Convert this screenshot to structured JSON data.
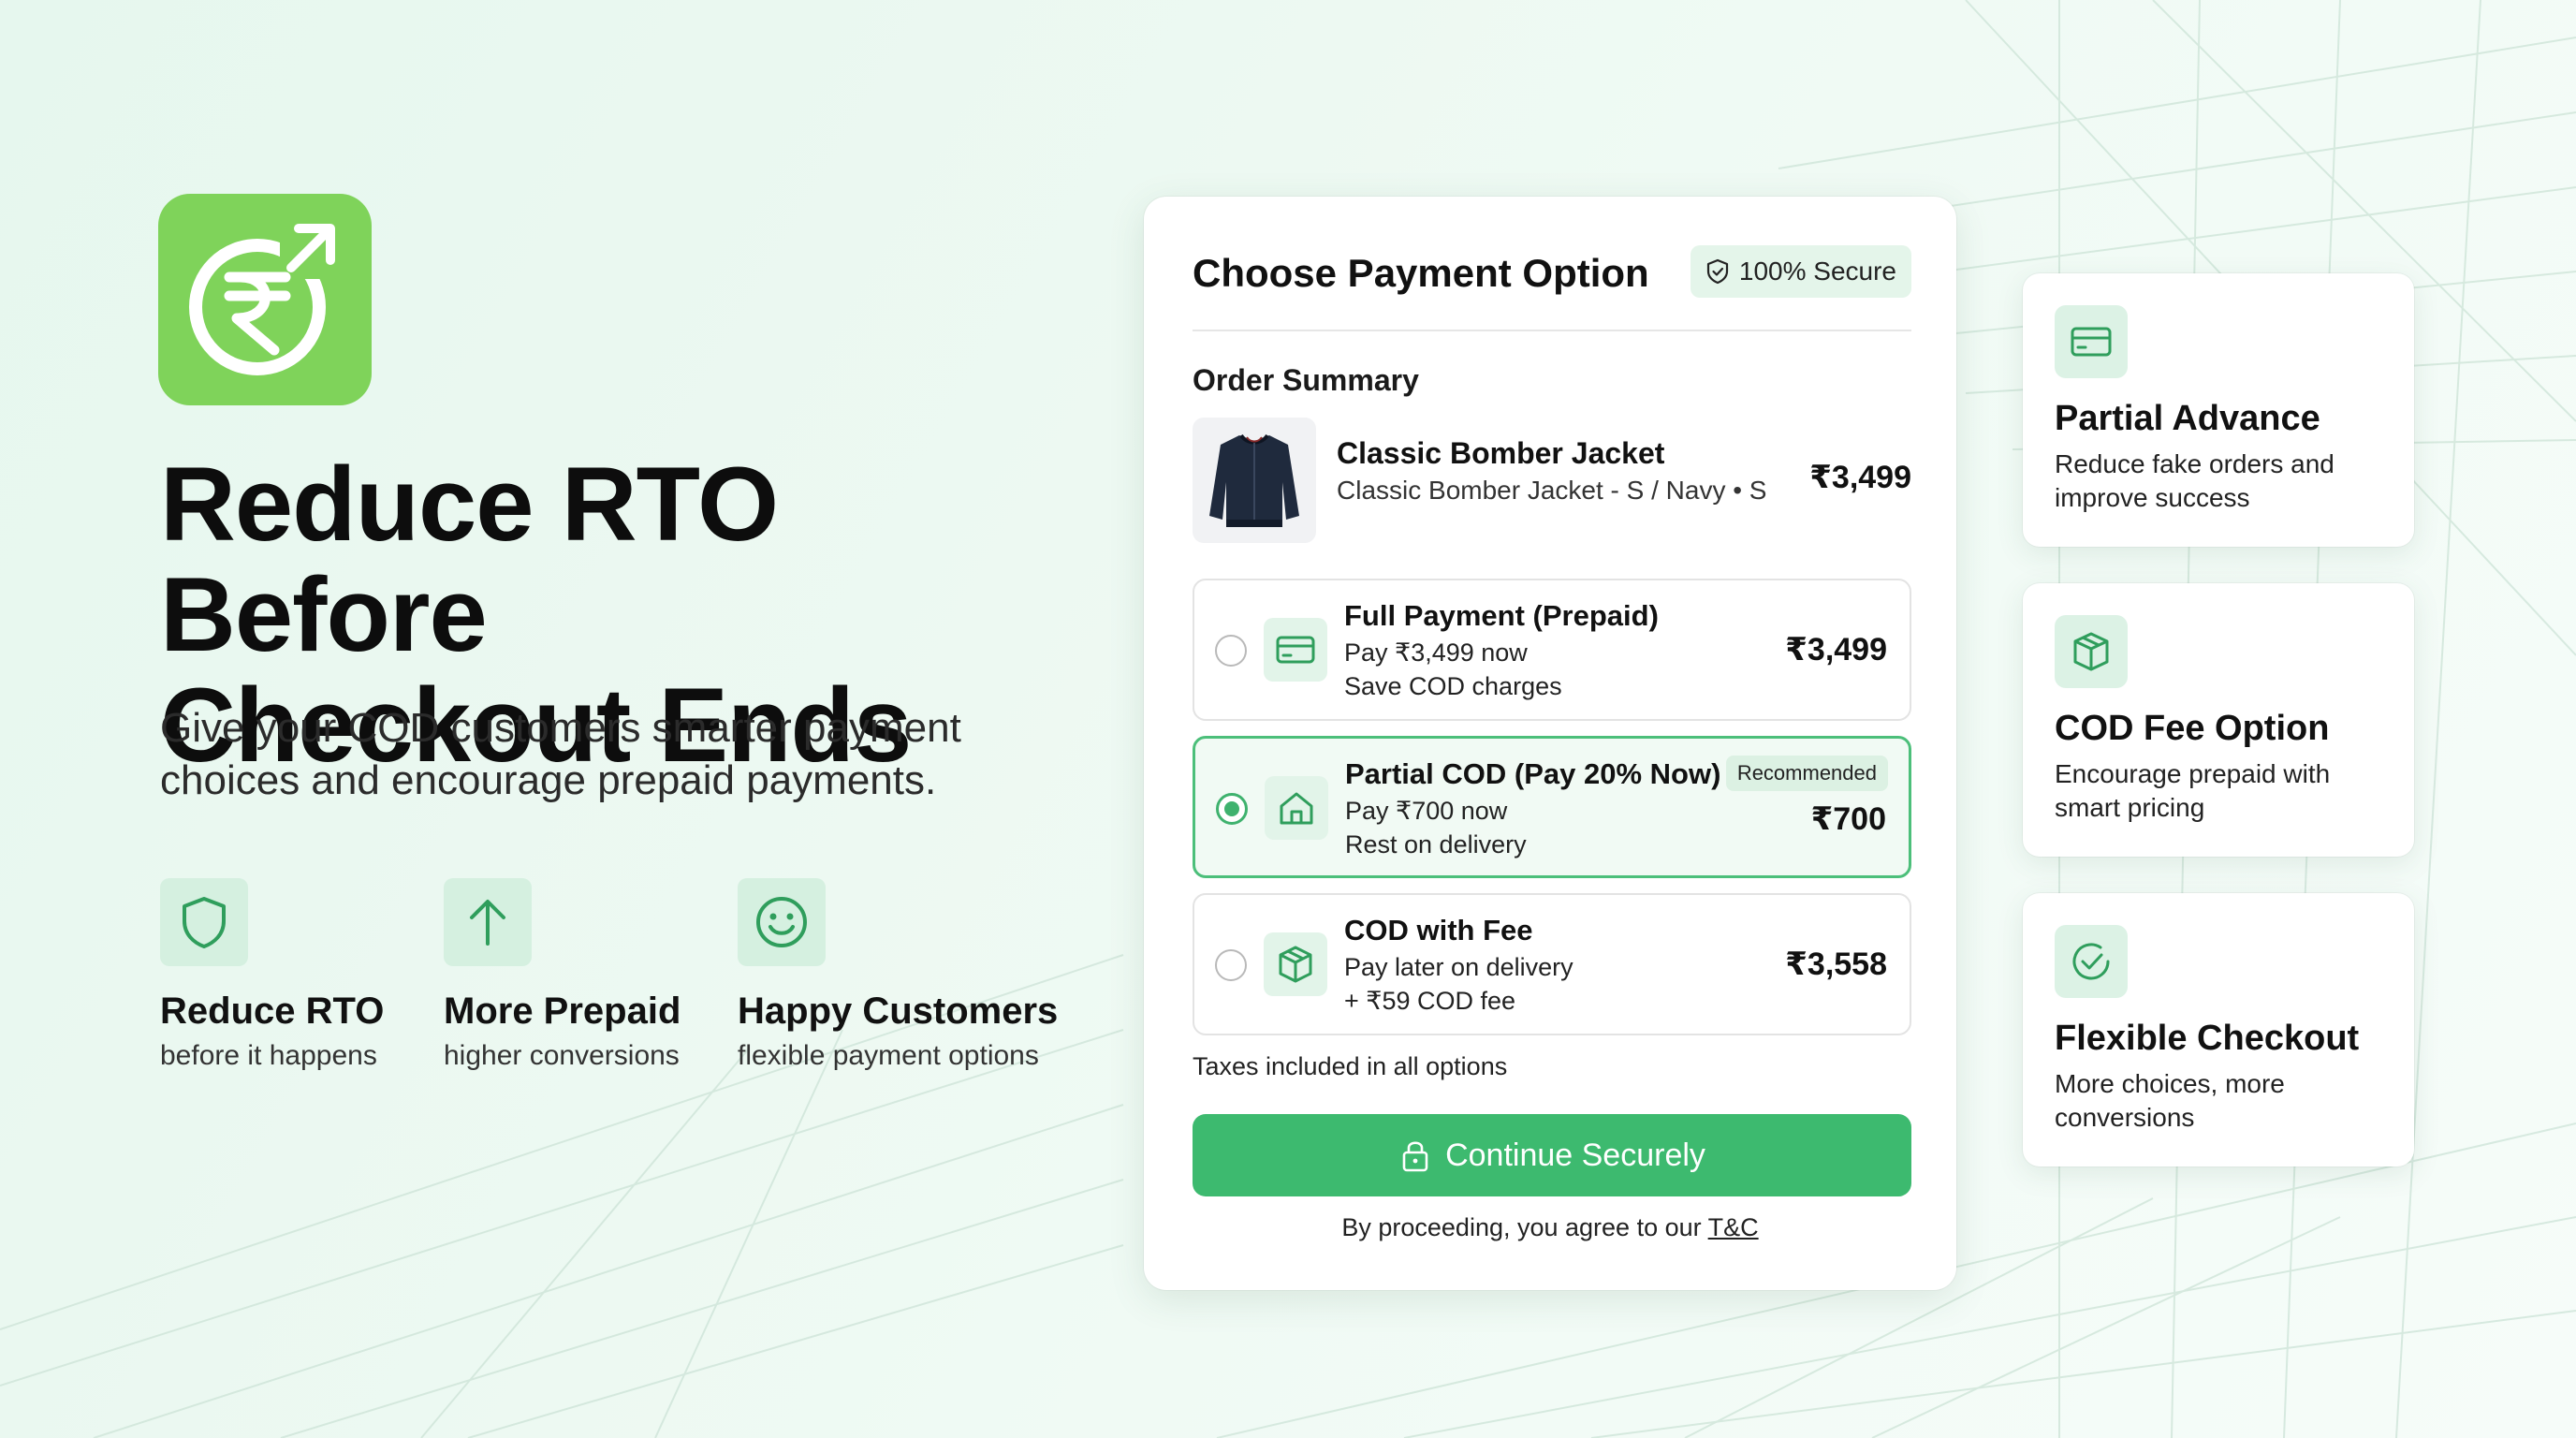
{
  "hero": {
    "headline_line1": "Reduce RTO Before",
    "headline_line2": "Checkout Ends",
    "subtext_line1": "Give your COD customers smarter payment",
    "subtext_line2": "choices and encourage prepaid payments."
  },
  "features": [
    {
      "icon": "shield-icon",
      "title": "Reduce RTO",
      "subtitle": "before it happens"
    },
    {
      "icon": "arrow-up-icon",
      "title": "More Prepaid",
      "subtitle": "higher conversions"
    },
    {
      "icon": "smiley-icon",
      "title": "Happy Customers",
      "subtitle": "flexible payment options"
    }
  ],
  "checkout": {
    "title": "Choose Payment Option",
    "secure_badge": "100% Secure",
    "order_summary_label": "Order Summary",
    "product": {
      "name": "Classic Bomber Jacket",
      "variant": "Classic Bomber Jacket - S / Navy • S",
      "price": "₹3,499"
    },
    "options": [
      {
        "title": "Full Payment (Prepaid)",
        "line1": "Pay ₹3,499 now",
        "line2": "Save COD charges",
        "price": "₹3,499",
        "icon": "credit-card-icon",
        "selected": false
      },
      {
        "title": "Partial COD (Pay 20% Now)",
        "line1": "Pay ₹700 now",
        "line2": "Rest on delivery",
        "price": "₹700",
        "icon": "home-icon",
        "selected": true,
        "badge": "Recommended"
      },
      {
        "title": "COD with Fee",
        "line1": "Pay later on delivery",
        "line2": "+ ₹59 COD fee",
        "price": "₹3,558",
        "icon": "box-icon",
        "selected": false
      }
    ],
    "taxes_note": "Taxes included in all options",
    "cta_label": "Continue Securely",
    "terms_prefix": "By proceeding, you agree to our ",
    "terms_link": "T&C"
  },
  "side_cards": [
    {
      "icon": "credit-card-icon",
      "title": "Partial Advance",
      "description": "Reduce fake orders and improve success"
    },
    {
      "icon": "box-icon",
      "title": "COD Fee Option",
      "description": "Encourage prepaid with smart pricing"
    },
    {
      "icon": "check-circle-icon",
      "title": "Flexible Checkout",
      "description": "More choices, more conversions"
    }
  ],
  "colors": {
    "brand_green": "#3dba6f",
    "logo_green": "#7fd35a",
    "icon_green": "#2f9e5c",
    "background": "#e9f8ef"
  }
}
